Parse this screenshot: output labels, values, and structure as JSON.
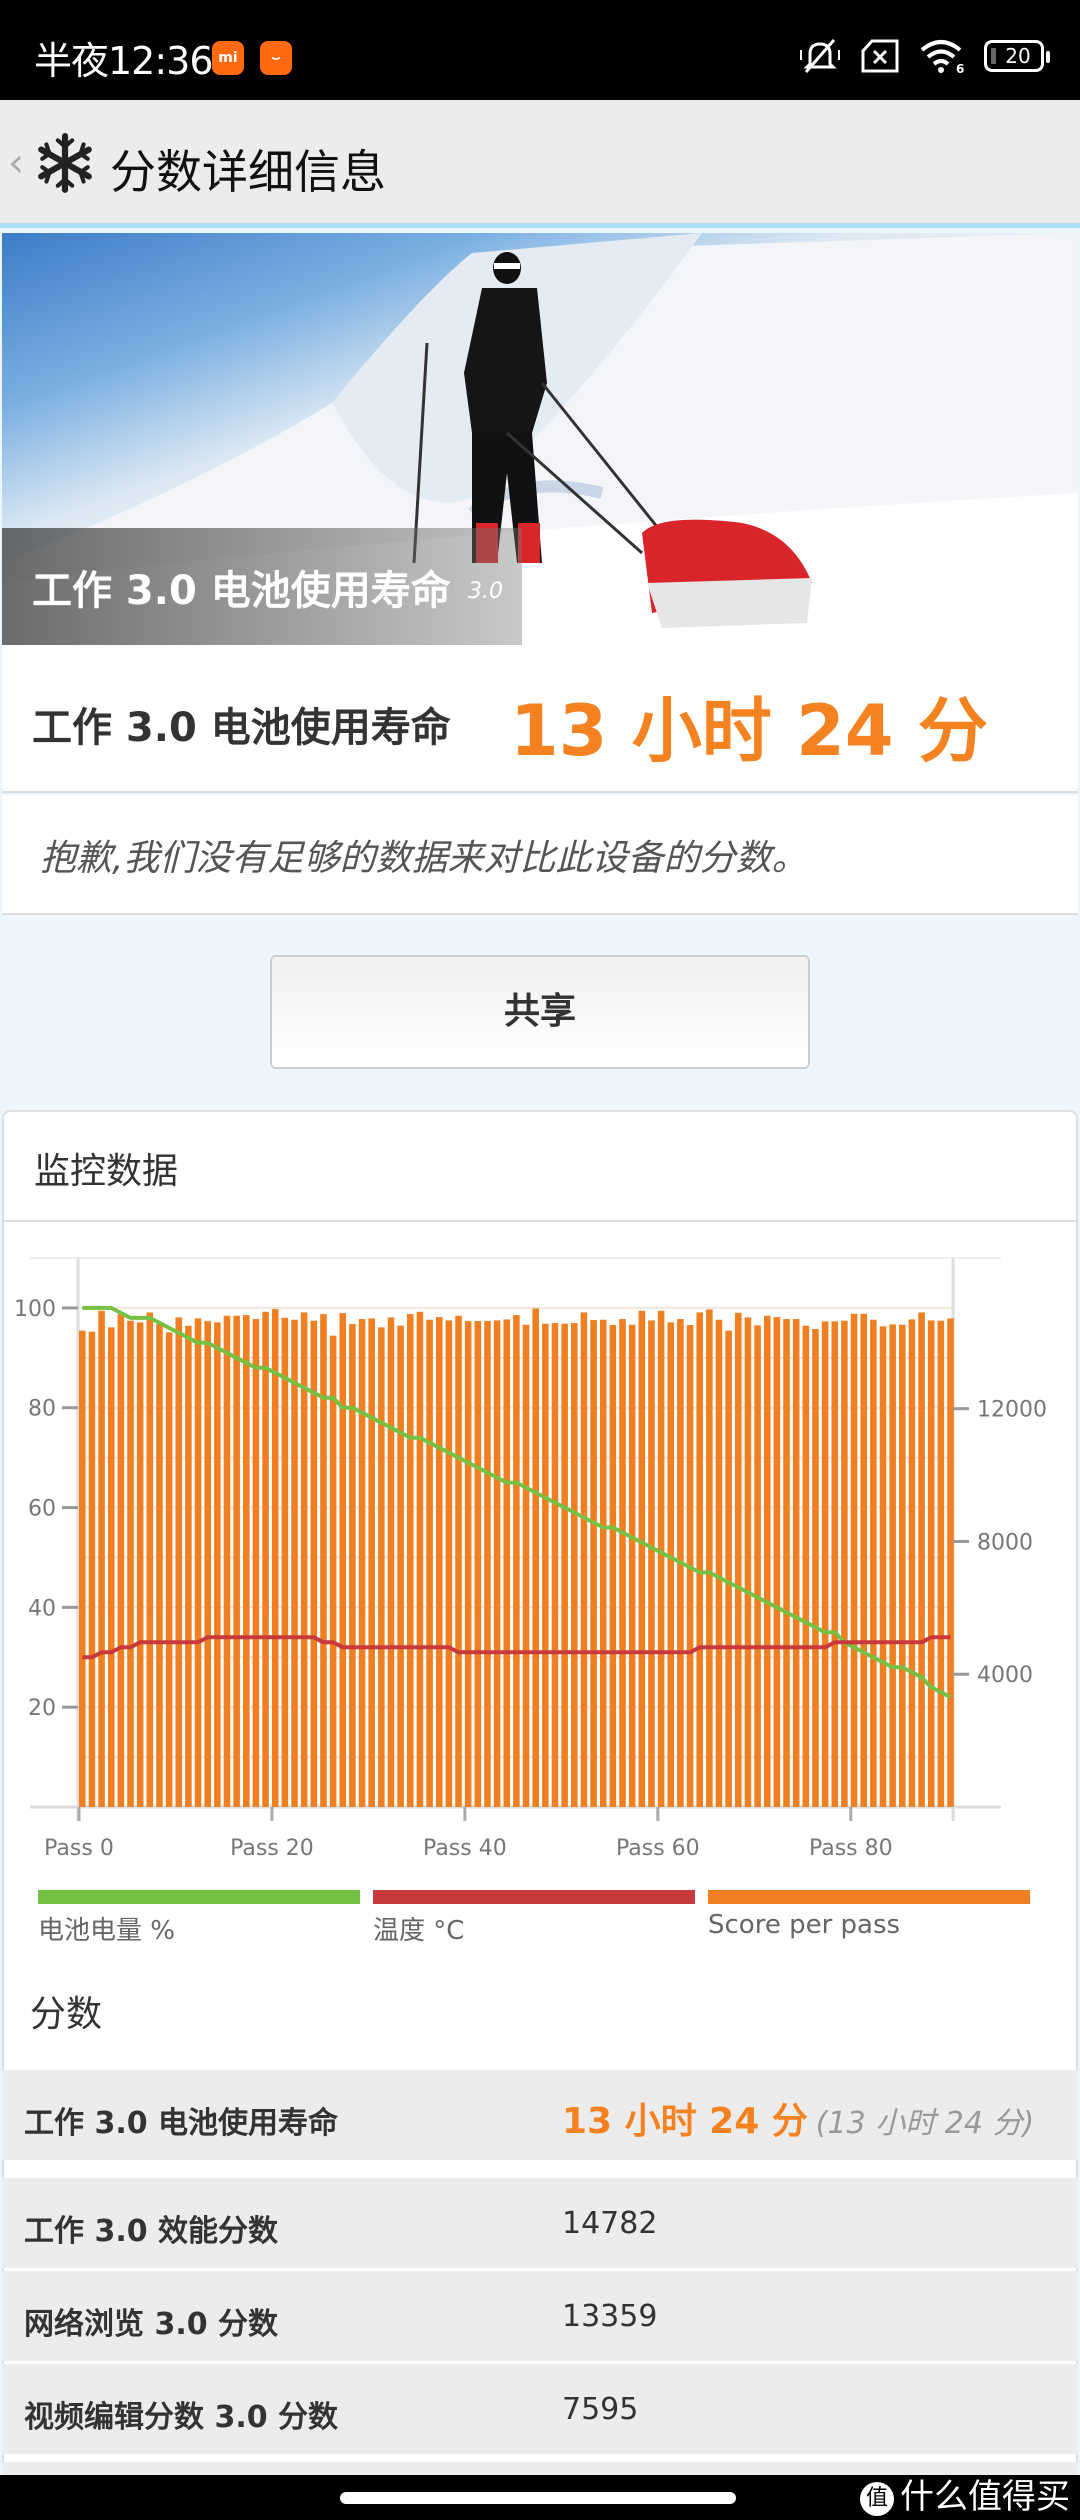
{
  "status_bar": {
    "time": "半夜12:36",
    "app_badges": [
      "mi",
      "mi-store"
    ],
    "icons": [
      "mute-bell-icon",
      "no-sim-icon",
      "wifi-6-icon",
      "battery-icon"
    ],
    "battery_level": "20"
  },
  "header": {
    "back_icon": "‹",
    "logo_icon": "snowflake-icon",
    "title": "分数详细信息"
  },
  "hero": {
    "title": "工作 3.0 电池使用寿命",
    "version": "3.0"
  },
  "result": {
    "label": "工作 3.0 电池使用寿命",
    "value": "13 小时 24 分"
  },
  "note": "抱歉,我们没有足够的数据来对比此设备的分数。",
  "share_button": "共享",
  "monitor": {
    "title": "监控数据"
  },
  "chart_data": {
    "type": "bar",
    "title": "",
    "xlabel": "",
    "ylabel": "",
    "x_tick_labels": [
      "Pass 0",
      "Pass 20",
      "Pass 40",
      "Pass 60",
      "Pass 80"
    ],
    "x_ticks": [
      0,
      20,
      40,
      60,
      80
    ],
    "x_range": [
      0,
      90
    ],
    "y_left_ticks": [
      20,
      40,
      60,
      80,
      100
    ],
    "y_left_range": [
      0,
      110
    ],
    "y_right_ticks": [
      4000,
      8000,
      12000
    ],
    "y_right_range": [
      0,
      16540
    ],
    "grid": true,
    "legend_placement": "bottom",
    "legend": [
      {
        "name": "电池电量 %",
        "color": "#76c043"
      },
      {
        "name": "温度 °C",
        "color": "#c8393b"
      },
      {
        "name": "Score per pass",
        "color": "#f07f21"
      }
    ],
    "series": [
      {
        "name": "Score per pass",
        "type": "bar",
        "axis": "right",
        "color": "#f07f21",
        "values": [
          14350,
          14320,
          14950,
          14450,
          14850,
          14650,
          14600,
          14900,
          14550,
          14300,
          14750,
          14500,
          14720,
          14640,
          14600,
          14800,
          14800,
          14820,
          14700,
          14920,
          15000,
          14740,
          14680,
          14900,
          14650,
          14850,
          14200,
          14880,
          14550,
          14700,
          14720,
          14450,
          14750,
          14500,
          14850,
          14920,
          14680,
          14760,
          14660,
          14800,
          14640,
          14640,
          14640,
          14660,
          14690,
          14820,
          14530,
          15020,
          14560,
          14580,
          14560,
          14580,
          14900,
          14670,
          14680,
          14520,
          14700,
          14530,
          14950,
          14660,
          14950,
          14600,
          14700,
          14520,
          14900,
          14990,
          14680,
          14350,
          14890,
          14750,
          14510,
          14800,
          14760,
          14700,
          14700,
          14500,
          14400,
          14630,
          14630,
          14650,
          14860,
          14860,
          14680,
          14480,
          14540,
          14530,
          14690,
          14900,
          14660,
          14650,
          14720
        ]
      },
      {
        "name": "电池电量 %",
        "type": "line",
        "axis": "left",
        "color": "#76c043",
        "values": [
          100,
          100,
          100,
          100,
          99,
          98,
          98,
          98,
          97,
          96,
          95,
          94,
          93,
          93,
          92,
          91,
          90,
          89,
          88,
          88,
          87,
          86,
          85,
          84,
          83,
          82,
          82,
          80,
          80,
          79,
          78,
          77,
          76,
          75,
          74,
          74,
          73,
          72,
          71,
          70,
          69,
          68,
          67,
          66,
          65,
          65,
          64,
          63,
          62,
          61,
          60,
          59,
          58,
          57,
          56,
          56,
          55,
          54,
          53,
          52,
          51,
          50,
          49,
          48,
          47,
          47,
          46,
          45,
          44,
          43,
          42,
          41,
          40,
          39,
          38,
          37,
          36,
          35,
          35,
          33,
          32,
          31,
          30,
          29,
          28,
          28,
          27,
          26,
          24,
          23,
          22
        ]
      },
      {
        "name": "温度 °C",
        "type": "line",
        "axis": "left",
        "color": "#c8393b",
        "values": [
          30,
          30,
          31,
          31,
          32,
          32,
          33,
          33,
          33,
          33,
          33,
          33,
          33,
          34,
          34,
          34,
          34,
          34,
          34,
          34,
          34,
          34,
          34,
          34,
          34,
          33,
          33,
          32,
          32,
          32,
          32,
          32,
          32,
          32,
          32,
          32,
          32,
          32,
          32,
          31,
          31,
          31,
          31,
          31,
          31,
          31,
          31,
          31,
          31,
          31,
          31,
          31,
          31,
          31,
          31,
          31,
          31,
          31,
          31,
          31,
          31,
          31,
          31,
          31,
          32,
          32,
          32,
          32,
          32,
          32,
          32,
          32,
          32,
          32,
          32,
          32,
          32,
          32,
          33,
          33,
          33,
          33,
          33,
          33,
          33,
          33,
          33,
          33,
          34,
          34,
          34
        ]
      }
    ]
  },
  "scores": {
    "title": "分数",
    "rows": [
      {
        "label": "工作 3.0 电池使用寿命",
        "value": "13 小时 24 分",
        "sub": "(13 小时 24 分)",
        "highlight": true
      },
      {
        "label": "工作 3.0 效能分数",
        "value": "14782"
      },
      {
        "label": "网络浏览 3.0 分数",
        "value": "13359"
      },
      {
        "label": "视频编辑分数 3.0 分数",
        "value": "7595"
      }
    ]
  },
  "watermark": {
    "icon": "值",
    "text": "什么值得买"
  }
}
